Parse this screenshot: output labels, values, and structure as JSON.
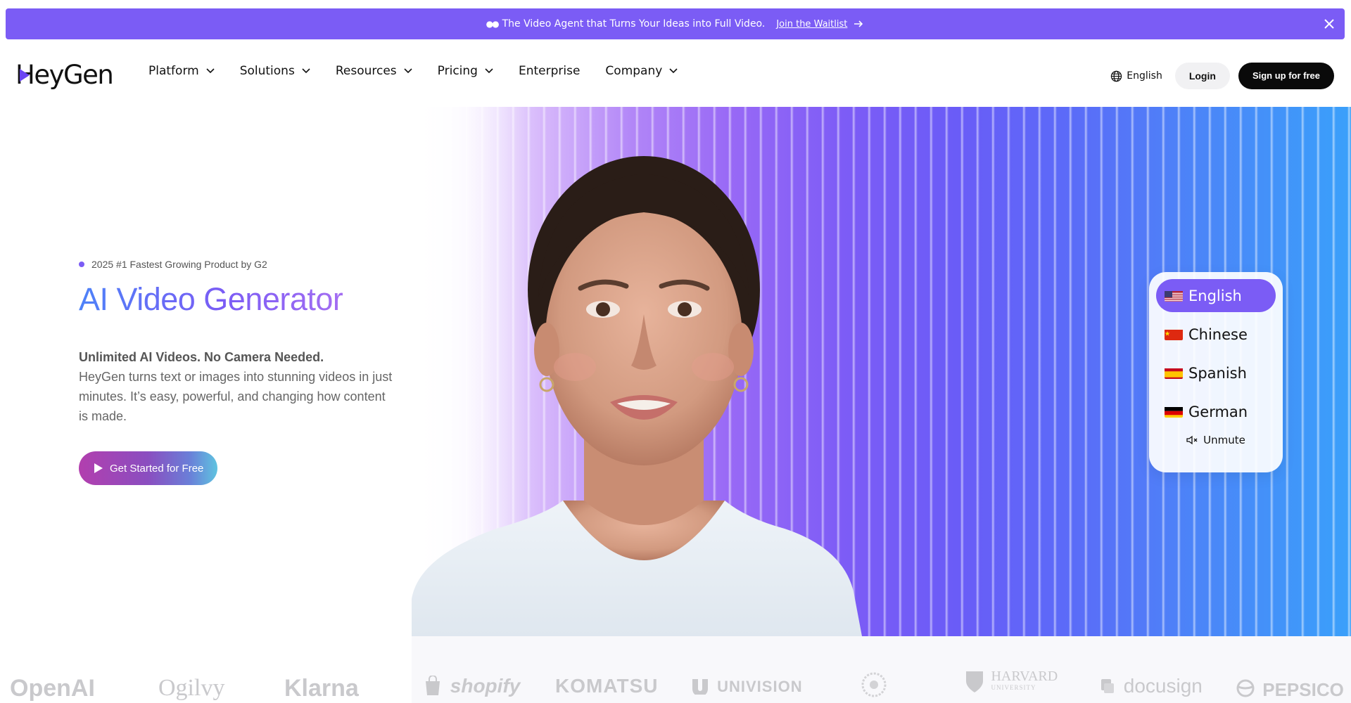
{
  "banner": {
    "text": "The Video Agent that Turns Your Ideas into Full Video.",
    "link": "Join the Waitlist",
    "icon_eyes": "eyes-icon",
    "icon_arrow": "arrow-right-icon",
    "icon_close": "close-icon",
    "color": "#7b5cf5"
  },
  "header": {
    "logo": "HeyGen",
    "nav": [
      {
        "label": "Platform",
        "dropdown": true
      },
      {
        "label": "Solutions",
        "dropdown": true
      },
      {
        "label": "Resources",
        "dropdown": true
      },
      {
        "label": "Pricing",
        "dropdown": true
      },
      {
        "label": "Enterprise",
        "dropdown": false
      },
      {
        "label": "Company",
        "dropdown": true
      }
    ],
    "language": "English",
    "login": "Login",
    "signup": "Sign up for free"
  },
  "hero": {
    "badge": "2025 #1 Fastest Growing Product by G2",
    "title": "AI Video Generator",
    "sub_strong": "Unlimited AI Videos. No Camera Needed.",
    "sub_body": "HeyGen turns text or images into stunning videos in just minutes. It’s easy, powerful, and changing how content is made.",
    "cta": "Get Started for Free"
  },
  "video_languages": {
    "options": [
      {
        "flag": "us",
        "label": "English",
        "active": true
      },
      {
        "flag": "cn",
        "label": "Chinese",
        "active": false
      },
      {
        "flag": "es",
        "label": "Spanish",
        "active": false
      },
      {
        "flag": "de",
        "label": "German",
        "active": false
      }
    ],
    "unmute": "Unmute"
  },
  "logos": [
    "OpenAI",
    "Ogilvy",
    "Klarna",
    "shopify",
    "KOMATSU",
    "UNIVISION",
    "HARVARD",
    "docusign",
    "PEPSICO"
  ],
  "logos_sub": {
    "harvard_sub": "UNIVERSITY"
  }
}
